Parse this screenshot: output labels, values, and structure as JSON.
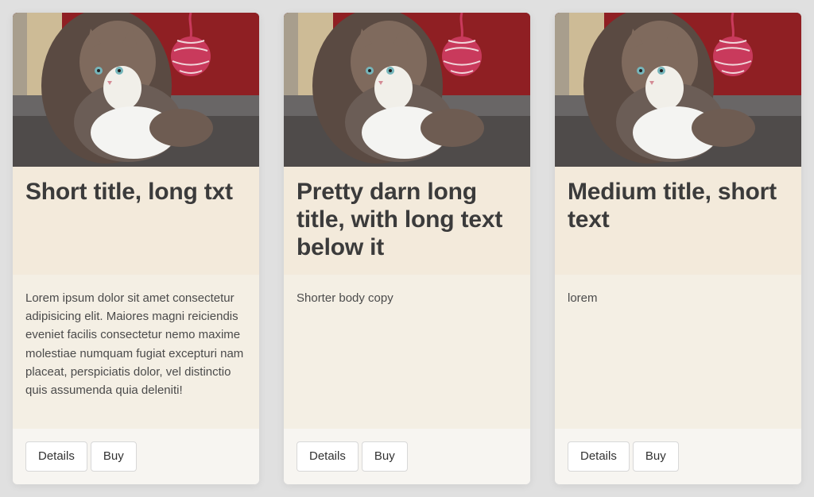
{
  "cards": [
    {
      "title": "Short title, long txt",
      "body": "Lorem ipsum dolor sit amet consectetur adipisicing elit. Maiores magni reiciendis eveniet facilis consectetur nemo maxime molestiae numquam fugiat excepturi nam placeat, perspiciatis dolor, vel distinctio quis assumenda quia deleniti!",
      "details_label": "Details",
      "buy_label": "Buy"
    },
    {
      "title": "Pretty darn long title, with long text below it",
      "body": "Shorter body copy",
      "details_label": "Details",
      "buy_label": "Buy"
    },
    {
      "title": "Medium title, short text",
      "body": "lorem",
      "details_label": "Details",
      "buy_label": "Buy"
    }
  ],
  "colors": {
    "page_background": "#e0e0e0",
    "card_header": "#f3eadb",
    "card_body": "#f4efe4",
    "card_footer": "#f7f5f1",
    "button_border": "#d8d8d8"
  },
  "image_icon": "kitten-photo"
}
